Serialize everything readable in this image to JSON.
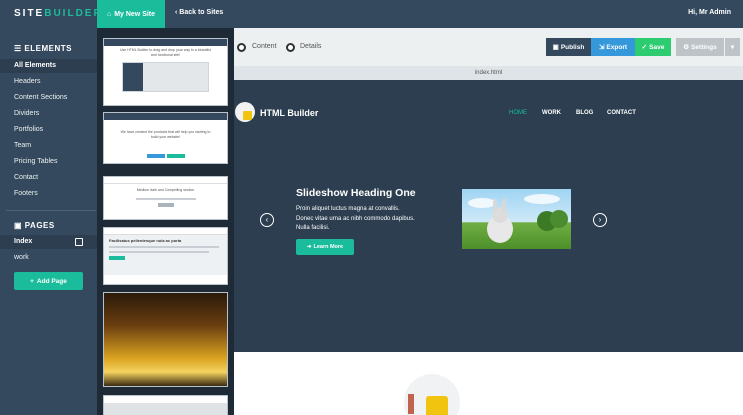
{
  "topbar": {
    "logo_part1": "SITE",
    "logo_part2": "BUILDER",
    "site_tab_label": "My New Site",
    "back_label": "Back to Sites",
    "user_label": "Hi, Mr Admin"
  },
  "sidebar": {
    "elements_header": "ELEMENTS",
    "items": [
      {
        "label": "All Elements",
        "active": true
      },
      {
        "label": "Headers"
      },
      {
        "label": "Content Sections"
      },
      {
        "label": "Dividers"
      },
      {
        "label": "Portfolios"
      },
      {
        "label": "Team"
      },
      {
        "label": "Pricing Tables"
      },
      {
        "label": "Contact"
      },
      {
        "label": "Footers"
      }
    ],
    "pages_header": "PAGES",
    "pages": [
      {
        "label": "Index",
        "active": true
      },
      {
        "label": "work"
      }
    ],
    "add_page_label": "Add Page"
  },
  "thumbnails": {
    "t1_text": "Use HTML Builder to drag and drop your way to a beautiful and functional site!",
    "t2_text": "We have created the products that will help you starting to build your website!",
    "t3_text": "Medium dark and Compelling section",
    "t4_text": "Facilisatus pellentesque nula ac porta"
  },
  "toolbar": {
    "radio_content": "Content",
    "radio_details": "Details",
    "publish_label": "Publish",
    "export_label": "Export",
    "save_label": "Save",
    "settings_label": "Settings"
  },
  "tab_name": "index.html",
  "preview": {
    "brand": "HTML Builder",
    "menu": [
      "HOME",
      "WORK",
      "BLOG",
      "CONTACT"
    ],
    "slide_title": "Slideshow Heading One",
    "slide_text": "Proin aliquet luctus magna at convallis. Donec vitae urna ac nibh commodo dapibus. Nulla facilisi.",
    "slide_button": "Learn More"
  },
  "colors": {
    "accent": "#1abc9c",
    "dark": "#2c3e50",
    "panel": "#34495e",
    "publish": "#34495e",
    "export": "#3498db",
    "save": "#2ecc71"
  }
}
